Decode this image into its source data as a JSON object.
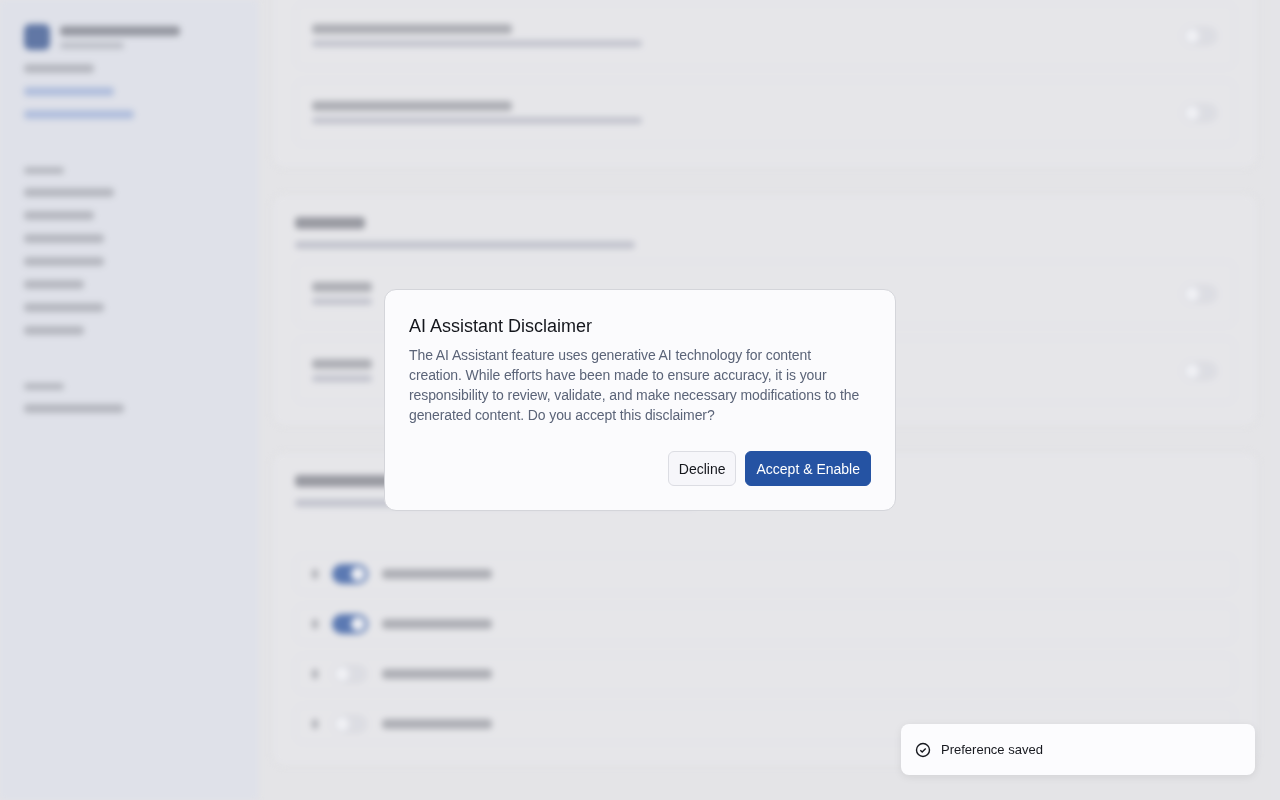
{
  "background": {
    "quick_action_toggles": [
      {
        "on": true
      },
      {
        "on": true
      },
      {
        "on": false
      },
      {
        "on": false
      }
    ],
    "feature_toggles": [
      {
        "on": false
      },
      {
        "on": false
      },
      {
        "on": false
      },
      {
        "on": false
      }
    ]
  },
  "dialog": {
    "title": "AI Assistant Disclaimer",
    "body": "The AI Assistant feature uses generative AI technology for content creation. While efforts have been made to ensure accuracy, it is your responsibility to review, validate, and make necessary modifications to the generated content. Do you accept this disclaimer?",
    "buttons": [
      {
        "label": "Decline",
        "kind": "secondary"
      },
      {
        "label": "Accept & Enable",
        "kind": "primary"
      }
    ]
  },
  "toast": {
    "message": "Preference saved"
  }
}
